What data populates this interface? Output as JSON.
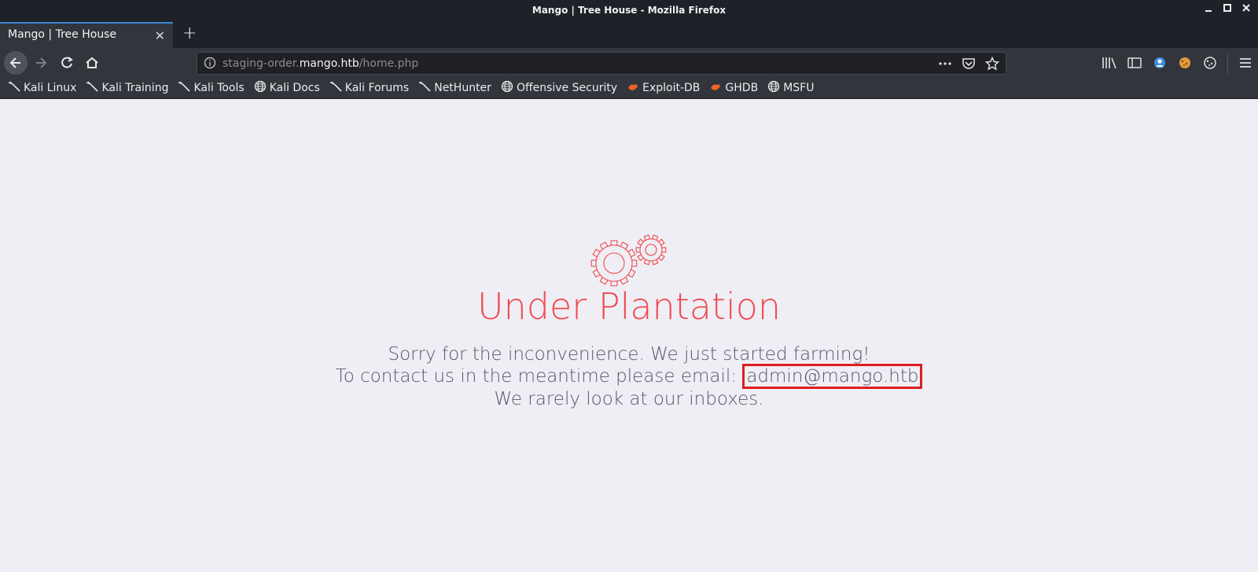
{
  "window": {
    "title": "Mango | Tree House - Mozilla Firefox",
    "controls": [
      "minimize",
      "maximize",
      "close"
    ]
  },
  "tab": {
    "label": "Mango | Tree House",
    "close": "✕",
    "new_tab": "+"
  },
  "nav": {
    "url_host_prefix": "staging-order.",
    "url_host": "mango.htb",
    "url_path": "/home.php"
  },
  "bookmarks": [
    {
      "label": "Kali Linux",
      "icon": "kali-dragon-icon"
    },
    {
      "label": "Kali Training",
      "icon": "kali-dragon-icon"
    },
    {
      "label": "Kali Tools",
      "icon": "kali-dragon-icon"
    },
    {
      "label": "Kali Docs",
      "icon": "globe-icon"
    },
    {
      "label": "Kali Forums",
      "icon": "kali-dragon-icon"
    },
    {
      "label": "NetHunter",
      "icon": "kali-dragon-icon"
    },
    {
      "label": "Offensive Security",
      "icon": "globe-icon"
    },
    {
      "label": "Exploit-DB",
      "icon": "exploit-db-icon"
    },
    {
      "label": "GHDB",
      "icon": "exploit-db-icon"
    },
    {
      "label": "MSFU",
      "icon": "globe-icon"
    }
  ],
  "page": {
    "heading": "Under Plantation",
    "line1": "Sorry for the inconvenience. We just started farming!",
    "line2_prefix": "To contact us in the meantime please email: ",
    "email": "admin@mango.htb",
    "line3": "We rarely look at our inboxes."
  },
  "colors": {
    "accent": "#ef4a4f",
    "highlight_box": "#e01b22",
    "text": "#535968"
  }
}
